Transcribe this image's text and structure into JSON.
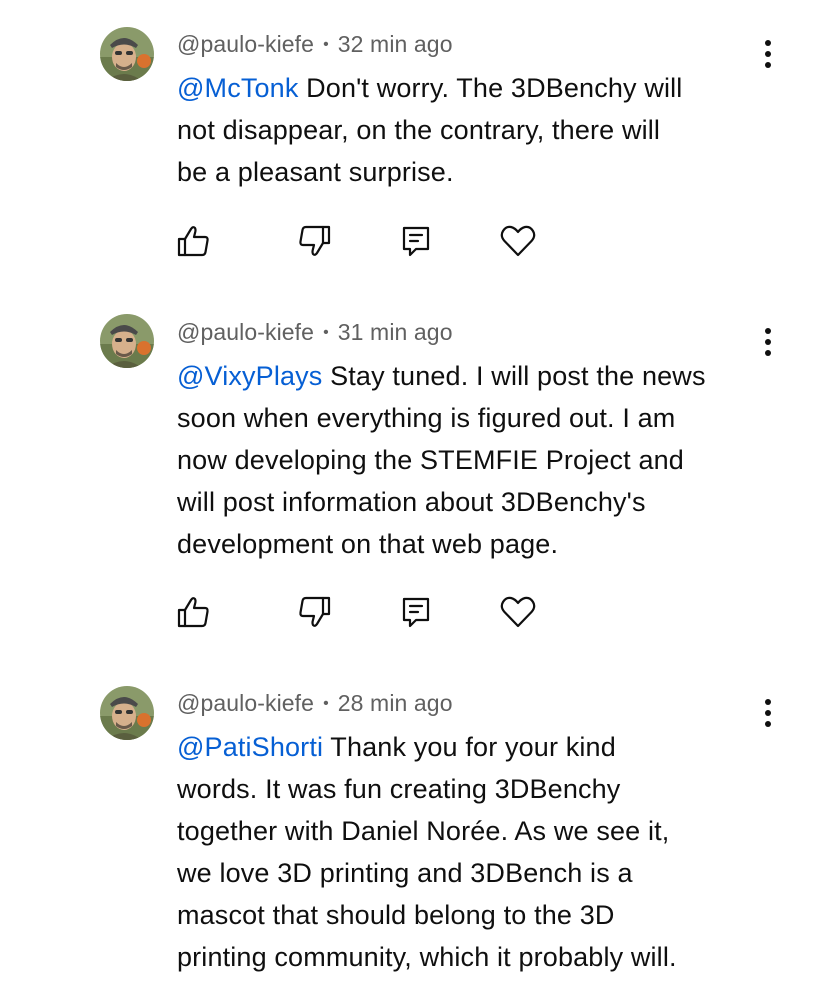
{
  "comments": [
    {
      "author": "@paulo-kiefe",
      "separator": "•",
      "time": "32 min ago",
      "mention": "@McTonk",
      "text": " Don't worry. The 3DBenchy will not disappear, on the contrary, there will be a pleasant surprise.",
      "lines": [
        "Don't worry. The 3DBenchy will",
        "not disappear, on the contrary, there will",
        "be a pleasant surprise."
      ]
    },
    {
      "author": "@paulo-kiefe",
      "separator": "•",
      "time": "31 min ago",
      "mention": "@VixyPlays",
      "text": " Stay tuned. I will post the news soon when everything is figured out. I am now developing the STEMFIE Project and will post information about 3DBenchy's development on that web page.",
      "lines": [
        "Stay tuned. I will post the news",
        "soon when everything is figured out. I am",
        "now developing the STEMFIE Project and",
        "will post information about 3DBenchy's",
        "development on that web page."
      ]
    },
    {
      "author": "@paulo-kiefe",
      "separator": "•",
      "time": "28 min ago",
      "mention": "@PatiShorti",
      "text": " Thank you for your kind words. It was fun creating 3DBenchy together with Daniel Norée. As we see it, we love 3D printing and 3DBench is a mascot that should belong to the 3D printing community, which it probably will.",
      "lines": [
        "Thank you for your kind",
        "words. It was fun creating 3DBenchy",
        "together with Daniel Norée. As we see it,",
        "we love 3D printing and 3DBench is a",
        "mascot that should belong to the 3D",
        "printing community, which it probably will."
      ]
    }
  ],
  "icons": {
    "like": "thumbs-up-icon",
    "dislike": "thumbs-down-icon",
    "reply": "reply-icon",
    "heart": "heart-icon",
    "more": "more-vertical-icon"
  },
  "colors": {
    "mention": "#065fd4",
    "meta": "#606060",
    "text": "#0f0f0f"
  }
}
